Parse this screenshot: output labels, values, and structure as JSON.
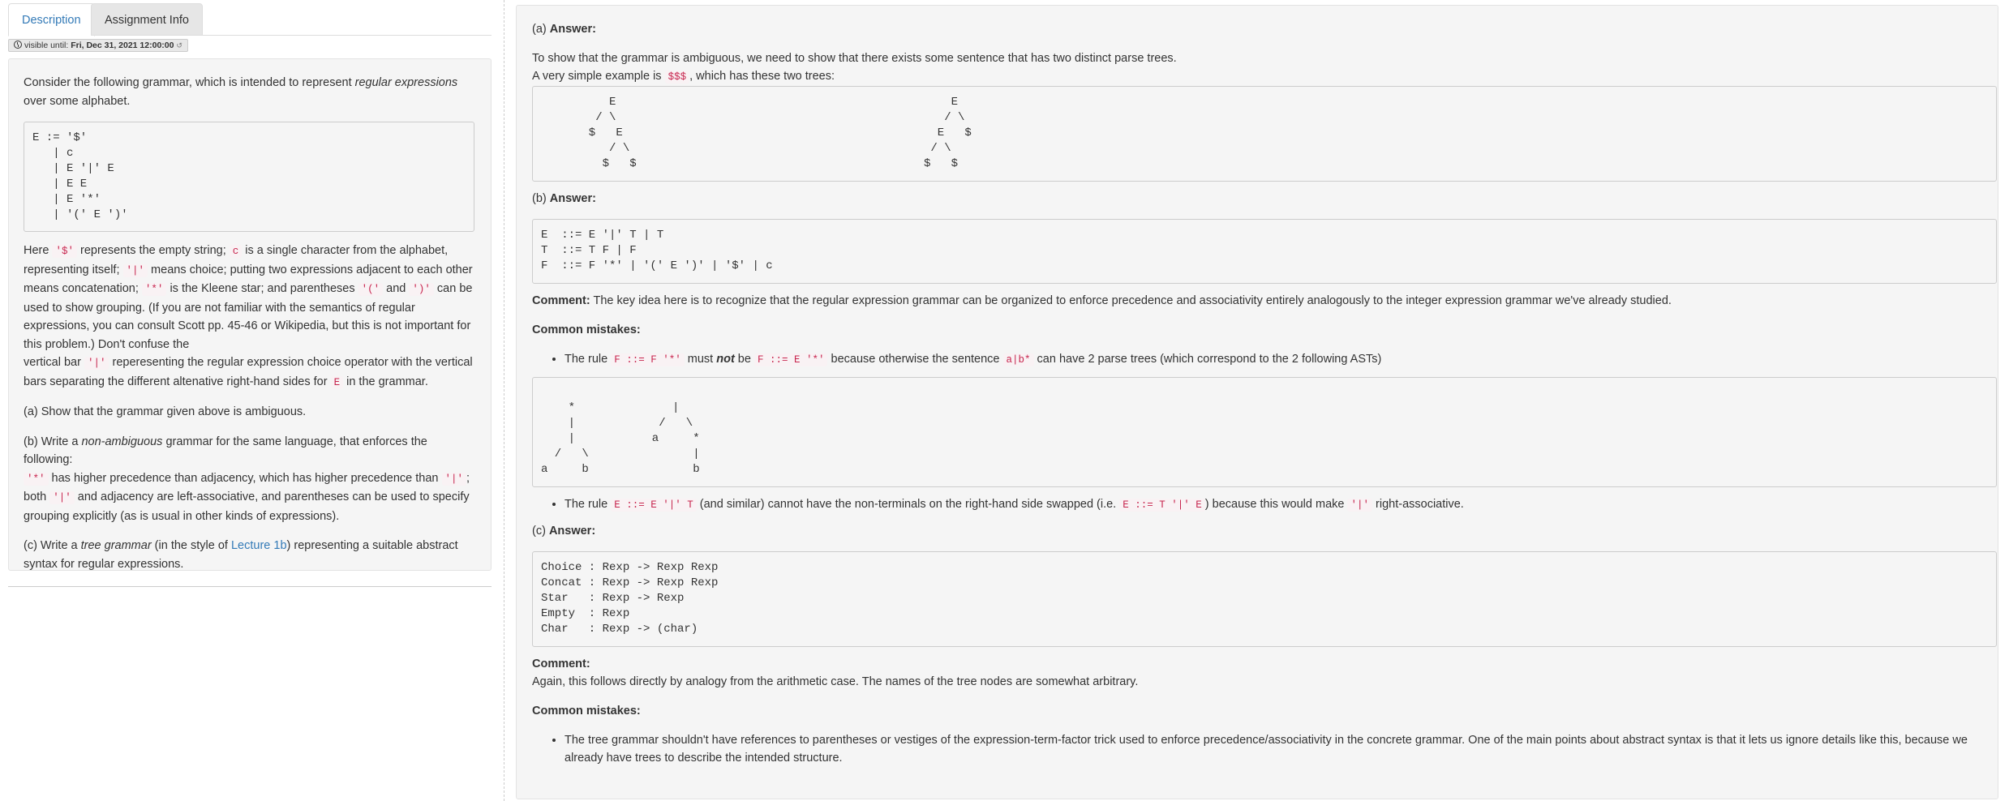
{
  "tabs": {
    "description": "Description",
    "assignment_info": "Assignment Info"
  },
  "visibility": {
    "label": "visible until:",
    "date": "Fri, Dec 31, 2021 12:00:00"
  },
  "question": {
    "intro_1": "Consider the following grammar, which is intended to represent ",
    "intro_em": "regular expressions",
    "intro_2": " over some alphabet.",
    "grammar": "E := '$'\n   | c\n   | E '|' E\n   | E E\n   | E '*'\n   | '(' E ')'",
    "here_1": "Here ",
    "code_dollar": "'$'",
    "here_2": " represents the empty string; ",
    "code_c": "c",
    "here_3": " is a single character from the alphabet, representing itself; ",
    "code_bar": "'|'",
    "here_4": " means choice; putting two expressions adjacent to each other means concatenation; ",
    "code_star": "'*'",
    "here_5": " is the Kleene star; and parentheses ",
    "code_lparen": "'('",
    "here_6": " and ",
    "code_rparen": "')'",
    "here_7": " can be used to show grouping. (If you are not familiar with the semantics of regular expressions, you can consult Scott pp. 45-46 or Wikipedia, but this is not important for this problem.) Don't confuse the",
    "here_8": "vertical bar ",
    "code_bar2": "'|'",
    "here_9": " reperesenting the regular expression choice operator with the vertical bars separating the different altenative right-hand sides for ",
    "code_E": "E",
    "here_10": " in the grammar.",
    "part_a": "(a) Show that the grammar given above is ambiguous.",
    "part_b_1": "(b) Write a ",
    "part_b_em": "non-ambiguous",
    "part_b_2": " grammar for the same language, that enforces the following:",
    "code_star2": "'*'",
    "part_b_3": " has higher precedence than adjacency, which has higher precedence than ",
    "code_bar3": "'|'",
    "part_b_4": "; both ",
    "code_bar4": "'|'",
    "part_b_5": " and adjacency are left-associative, and parentheses can be used to specify grouping explicitly (as is usual in other kinds of expressions).",
    "part_c_1": "(c) Write a ",
    "part_c_em": "tree grammar",
    "part_c_2": " (in the style of ",
    "part_c_link": "Lecture 1b",
    "part_c_3": ") representing a suitable abstract syntax for regular expressions."
  },
  "answer": {
    "a_label": "(a) ",
    "answer_word": "Answer:",
    "a_text_1": "To show that the grammar is ambiguous, we need to show that there exists some sentence that has two distinct parse trees.",
    "a_text_2a": "A very simple example is ",
    "a_code": "$$$",
    "a_text_2b": ", which has these two trees:",
    "tree_left": "          E\n        / \\\n       $   E\n          / \\\n         $   $",
    "tree_right": "         E\n        / \\\n       E   $\n      / \\\n     $   $",
    "b_label": "(b) ",
    "b_grammar": "E  ::= E '|' T | T\nT  ::= T F | F\nF  ::= F '*' | '(' E ')' | '$' | c",
    "comment_word": "Comment:",
    "b_comment": " The key idea here is to recognize that the regular expression grammar can be organized to enforce precedence and associativity entirely analogously to the integer expression grammar we've already studied.",
    "mistakes_word": "Common mistakes:",
    "m1_1": "The rule ",
    "m1_code1": "F ::= F '*'",
    "m1_2": " must ",
    "m1_em": "not",
    "m1_3": " be ",
    "m1_code2": "F ::= E '*'",
    "m1_4": " because otherwise the sentence ",
    "m1_code3": "a|b*",
    "m1_5": " can have 2 parse trees (which correspond to the 2 following ASTs)",
    "ast_left": "    *\n    |\n    |\n  /   \\\na     b",
    "ast_right": "     |\n   /   \\\n  a     *\n        |\n        b",
    "m2_1": "The rule ",
    "m2_code1": "E ::= E '|' T",
    "m2_2": " (and similar) cannot have the non-terminals on the right-hand side swapped (i.e. ",
    "m2_code2": "E ::= T '|' E",
    "m2_3": ") because this would make ",
    "m2_code3": "'|'",
    "m2_4": " right-associative.",
    "c_label": "(c) ",
    "c_grammar": "Choice : Rexp -> Rexp Rexp\nConcat : Rexp -> Rexp Rexp\nStar   : Rexp -> Rexp\nEmpty  : Rexp\nChar   : Rexp -> (char)",
    "c_comment": "Again, this follows directly by analogy from the arithmetic case. The names of the tree nodes are somewhat arbitrary.",
    "c_mistake": "The tree grammar shouldn't have references to parentheses or vestiges of the expression-term-factor trick used to enforce precedence/associativity in the concrete grammar. One of the main points about abstract syntax is that it lets us ignore details like this, because we already have trees to describe the intended structure."
  }
}
